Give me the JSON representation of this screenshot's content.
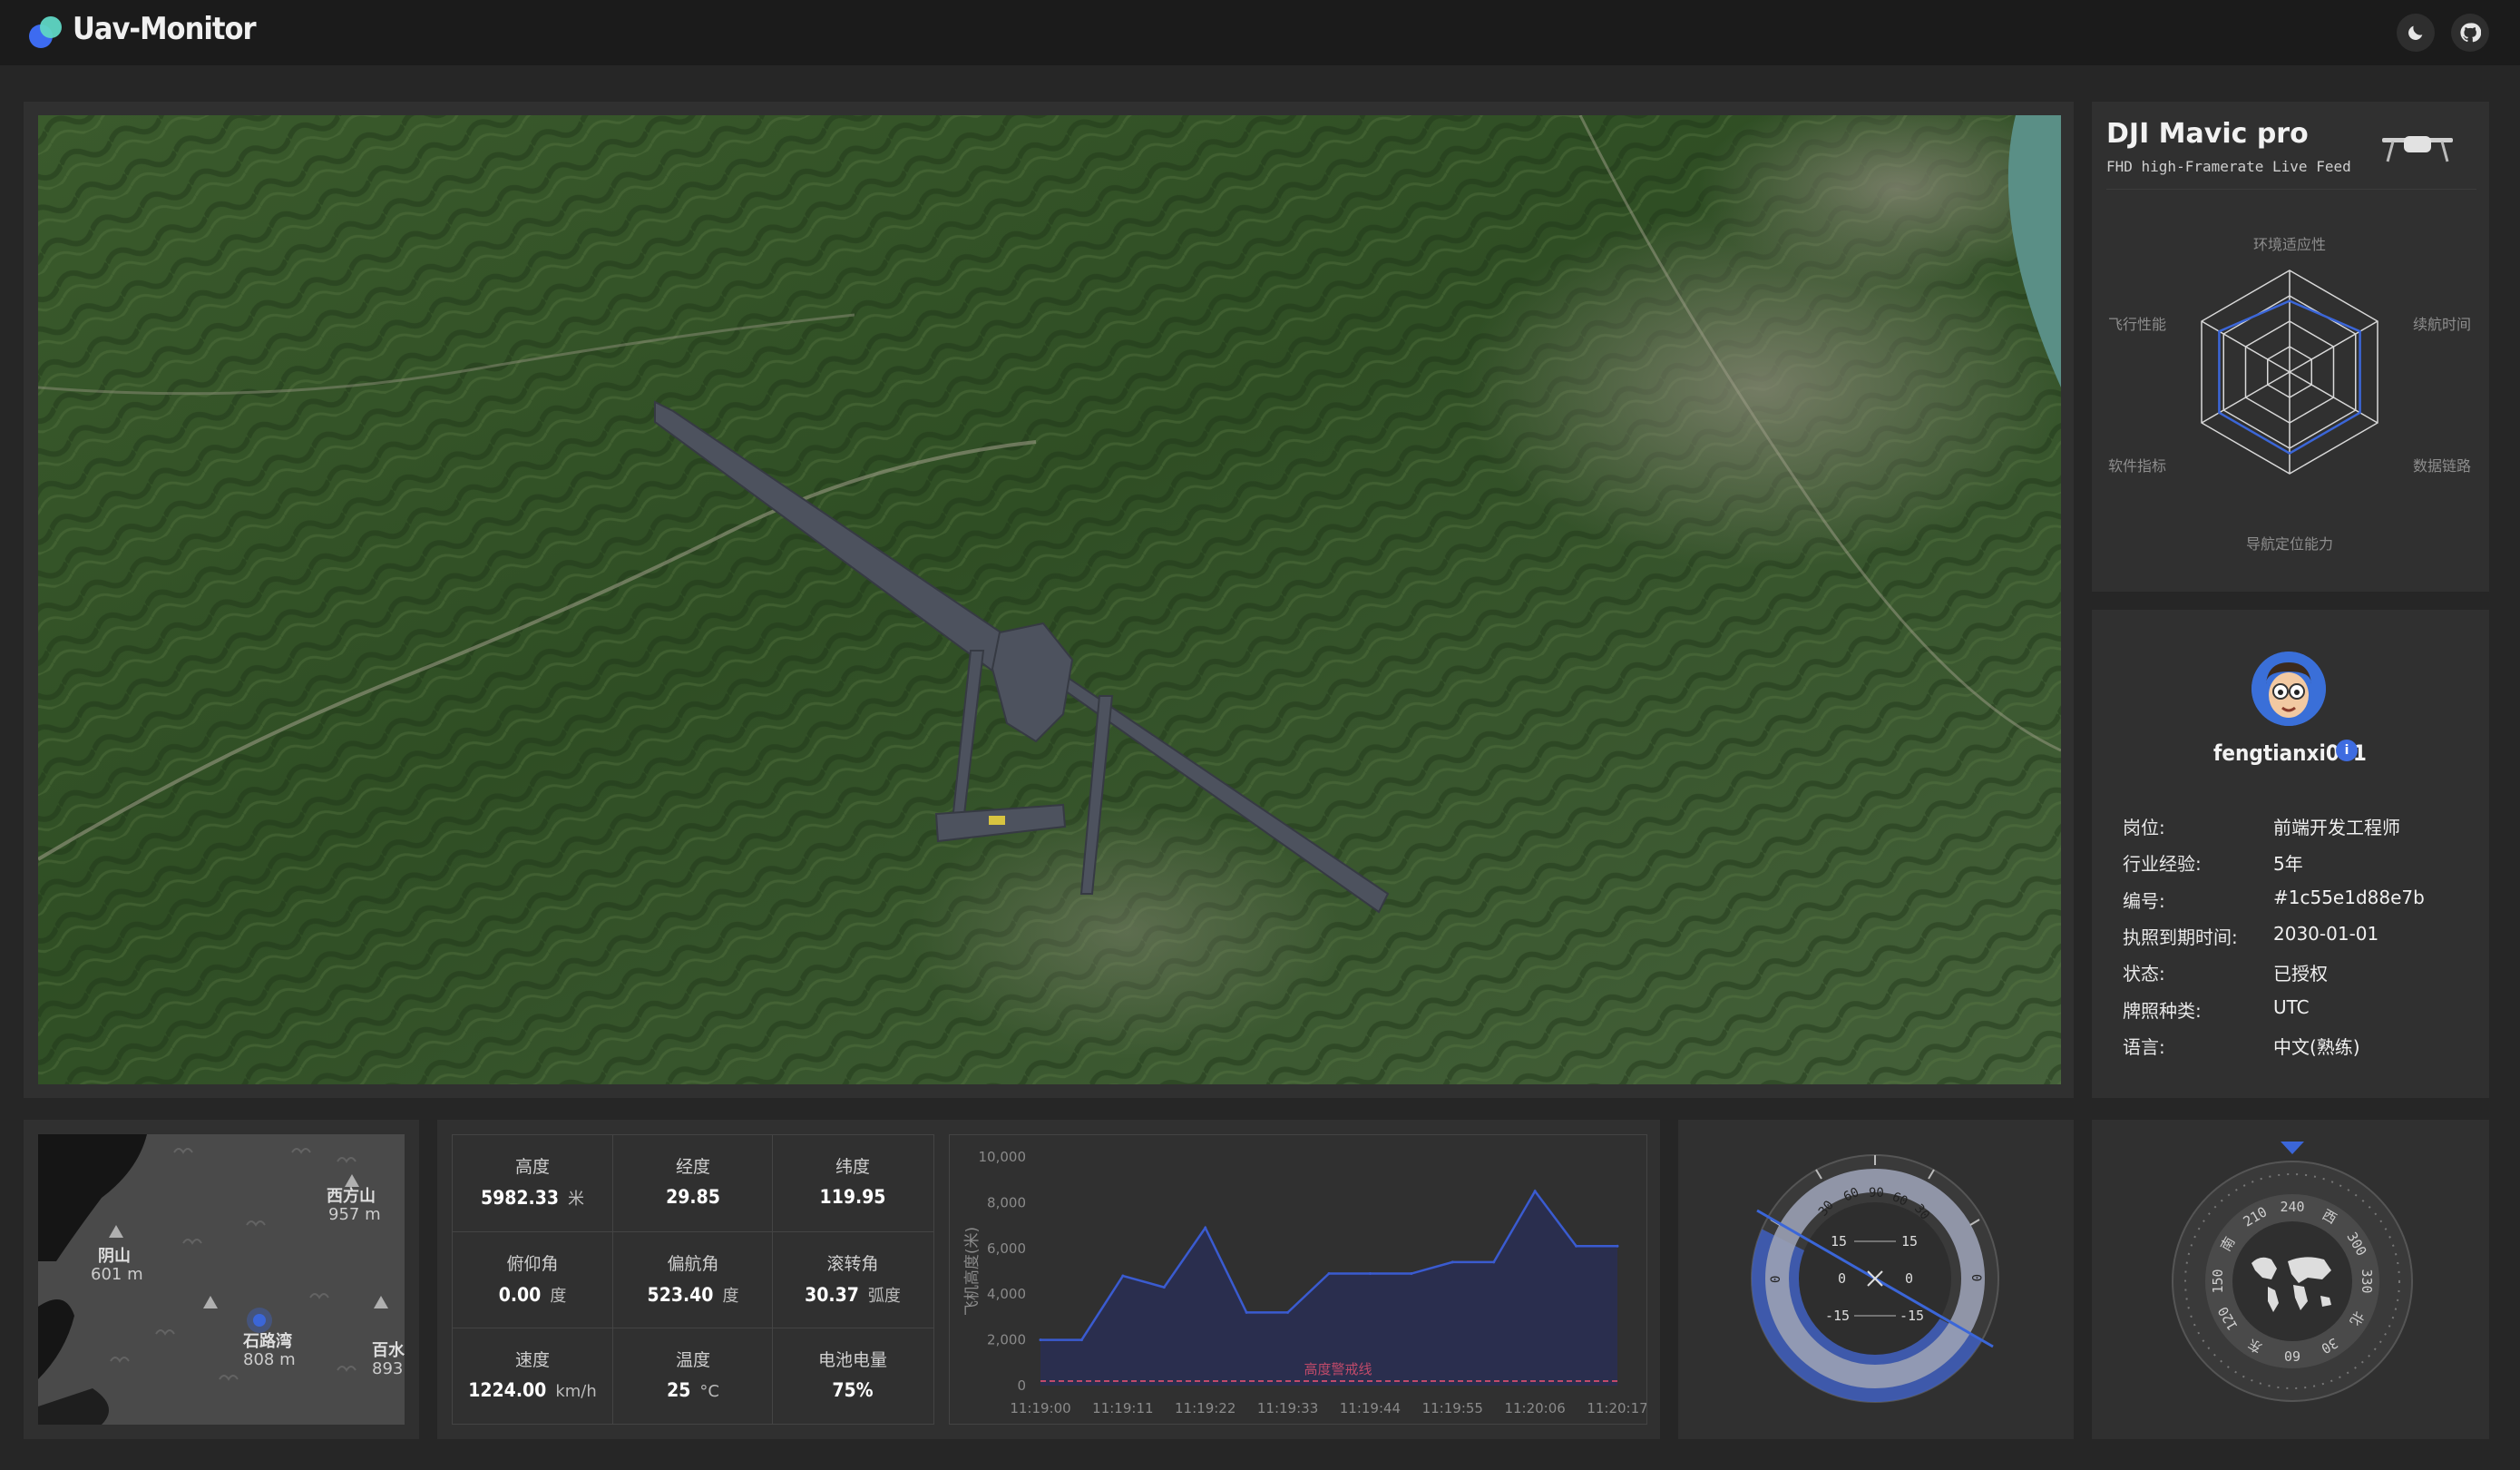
{
  "app": {
    "title": "Uav-Monitor"
  },
  "drone": {
    "name": "DJI Mavic pro",
    "subtitle": "FHD high-Framerate Live Feed"
  },
  "radar": {
    "labels": {
      "top": "环境适应性",
      "top_right": "续航时间",
      "bottom_right": "数据链路",
      "bottom": "导航定位能力",
      "bottom_left": "软件指标",
      "top_left": "飞行性能"
    },
    "values": [
      0.7,
      0.8,
      0.8,
      0.8,
      0.8,
      0.8
    ],
    "color": "#3b66d8"
  },
  "user": {
    "name": "fengtianxi001",
    "verify_icon": "ⅰ",
    "rows": [
      {
        "label": "岗位:",
        "value": "前端开发工程师"
      },
      {
        "label": "行业经验:",
        "value": "5年"
      },
      {
        "label": "编号:",
        "value": "#1c55e1d88e7b"
      },
      {
        "label": "执照到期时间:",
        "value": "2030-01-01"
      },
      {
        "label": "状态:",
        "value": "已授权"
      },
      {
        "label": "牌照种类:",
        "value": "UTC"
      },
      {
        "label": "语言:",
        "value": "中文(熟练)"
      }
    ]
  },
  "minimap": {
    "places": [
      {
        "name": "西方山",
        "elev": "957 m"
      },
      {
        "name": "阴山",
        "elev": "601 m"
      },
      {
        "name": "石路湾",
        "elev": "808 m"
      },
      {
        "name": "百水",
        "elev": "893"
      }
    ]
  },
  "stats": [
    {
      "label": "高度",
      "value": "5982.33",
      "unit": "米"
    },
    {
      "label": "经度",
      "value": "29.85",
      "unit": ""
    },
    {
      "label": "纬度",
      "value": "119.95",
      "unit": ""
    },
    {
      "label": "俯仰角",
      "value": "0.00",
      "unit": "度"
    },
    {
      "label": "偏航角",
      "value": "523.40",
      "unit": "度"
    },
    {
      "label": "滚转角",
      "value": "30.37",
      "unit": "弧度"
    },
    {
      "label": "速度",
      "value": "1224.00",
      "unit": "km/h"
    },
    {
      "label": "温度",
      "value": "25",
      "unit": "°C"
    },
    {
      "label": "电池电量",
      "value": "75%",
      "unit": ""
    }
  ],
  "chart_data": {
    "type": "area",
    "ylabel": "飞机高度(米)",
    "x": [
      "11:19:00",
      "11:19:05",
      "11:19:11",
      "11:19:16",
      "11:19:22",
      "11:19:27",
      "11:19:33",
      "11:19:38",
      "11:19:44",
      "11:19:49",
      "11:19:55",
      "11:20:00",
      "11:20:06",
      "11:20:11",
      "11:20:17"
    ],
    "x_tick_labels": [
      "11:19:00",
      "11:19:11",
      "11:19:22",
      "11:19:33",
      "11:19:44",
      "11:19:55",
      "11:20:06",
      "11:20:17"
    ],
    "values": [
      2000,
      2000,
      4800,
      4300,
      6900,
      3200,
      3200,
      4900,
      4900,
      4900,
      5400,
      5400,
      8500,
      6100,
      6100
    ],
    "y_ticks": [
      "10,000",
      "8,000",
      "6,000",
      "4,000",
      "2,000",
      "0"
    ],
    "ylim": [
      0,
      10000
    ],
    "warning_line": {
      "label": "高度警戒线",
      "value": 200
    },
    "line_color": "#3a5bd0",
    "fill_color": "#2a2f52"
  },
  "attitude": {
    "ticks_top": [
      "30",
      "60",
      "90",
      "60",
      "30"
    ],
    "side": [
      "0",
      "0"
    ],
    "inner": [
      "15",
      "15",
      "0",
      "0",
      "-15",
      "-15"
    ],
    "roll_deg": 30.37
  },
  "compass": {
    "labels": [
      "南",
      "210",
      "240",
      "西",
      "300",
      "330",
      "北",
      "30",
      "60",
      "东",
      "120",
      "150"
    ]
  }
}
